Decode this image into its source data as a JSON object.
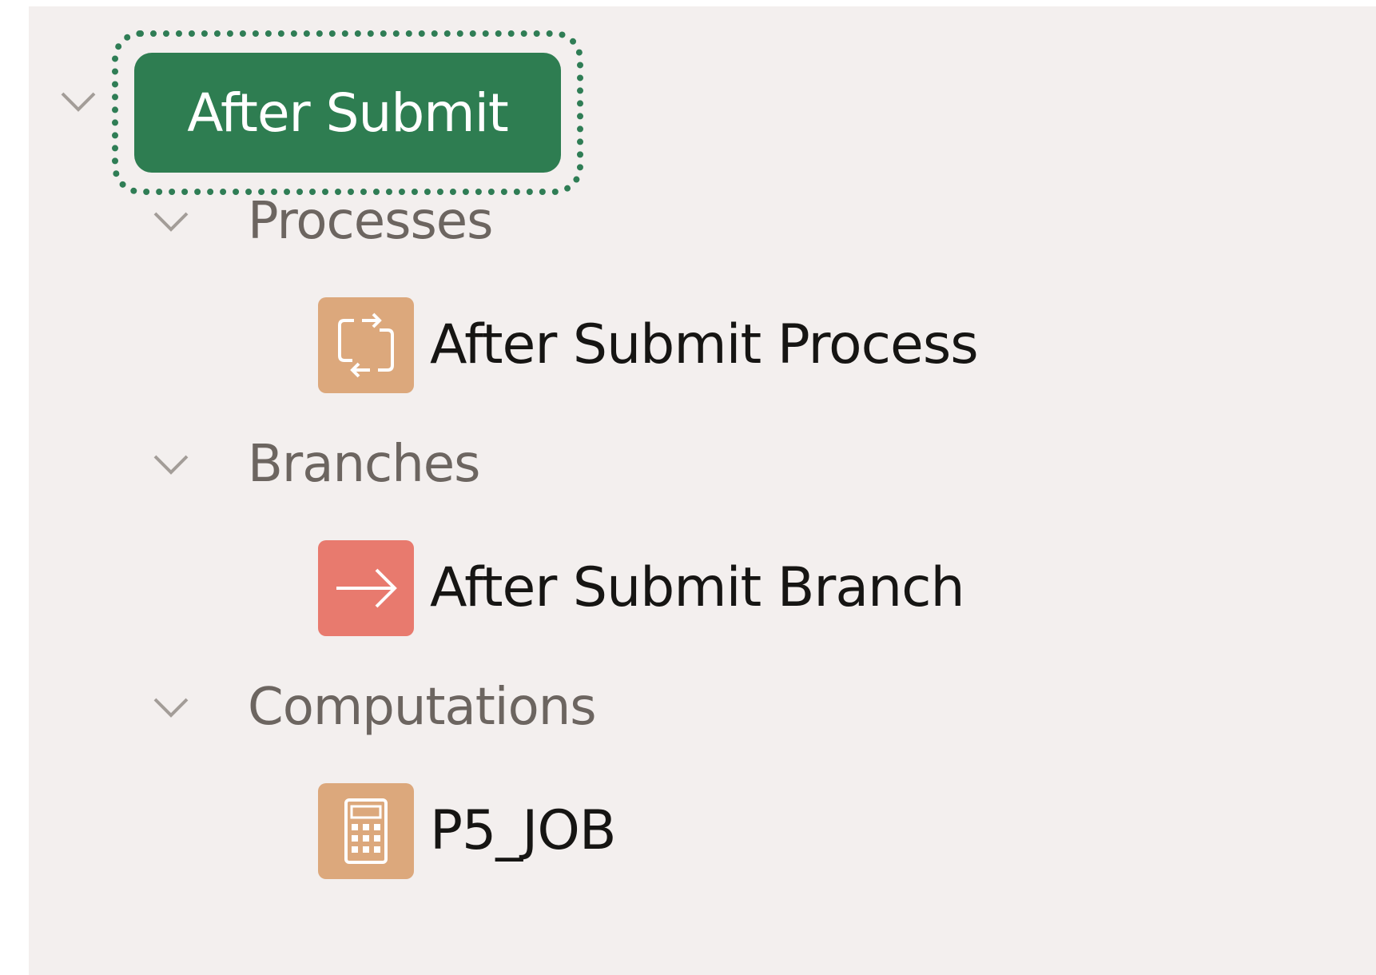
{
  "tree": {
    "root": {
      "label": "After Submit",
      "expanded": true,
      "selected": true
    },
    "groups": [
      {
        "label": "Processes",
        "expanded": true,
        "items": [
          {
            "label": "After Submit Process",
            "icon": "process-loop-icon",
            "icon_color": "#dca87c"
          }
        ]
      },
      {
        "label": "Branches",
        "expanded": true,
        "items": [
          {
            "label": "After Submit Branch",
            "icon": "branch-arrow-icon",
            "icon_color": "#e87a6e"
          }
        ]
      },
      {
        "label": "Computations",
        "expanded": true,
        "items": [
          {
            "label": "P5_JOB",
            "icon": "calculator-icon",
            "icon_color": "#dca87c"
          }
        ]
      }
    ]
  },
  "colors": {
    "panel_bg": "#f3efee",
    "selected_bg": "#2e7d51",
    "group_text": "#6c6560",
    "item_text": "#161513",
    "chevron": "#a39d98"
  }
}
